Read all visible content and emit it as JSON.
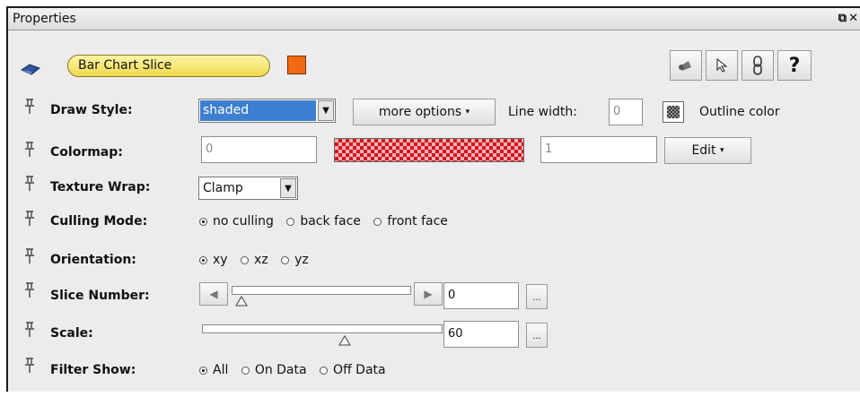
{
  "window": {
    "title": "Properties",
    "float_icon": "float-icon",
    "close_icon": "close-icon"
  },
  "header": {
    "object_name": "Bar Chart Slice",
    "color_swatch": "#f06a14",
    "toolbar": [
      "camera-icon",
      "pointer-icon",
      "link-icon",
      "help-icon"
    ],
    "help_label": "?"
  },
  "rows": {
    "draw_style": {
      "label": "Draw Style:",
      "value": "shaded",
      "more_options": "more options",
      "line_width_label": "Line width:",
      "line_width_value": "0",
      "outline_label": "Outline color"
    },
    "colormap": {
      "label": "Colormap:",
      "min_placeholder": "0",
      "max_placeholder": "1",
      "edit_label": "Edit"
    },
    "texture_wrap": {
      "label": "Texture Wrap:",
      "value": "Clamp"
    },
    "culling_mode": {
      "label": "Culling Mode:",
      "options": [
        "no culling",
        "back face",
        "front face"
      ],
      "selected": 0
    },
    "orientation": {
      "label": "Orientation:",
      "options": [
        "xy",
        "xz",
        "yz"
      ],
      "selected": 0
    },
    "slice_number": {
      "label": "Slice Number:",
      "value": "0",
      "level": 0.0,
      "more": "..."
    },
    "scale": {
      "label": "Scale:",
      "value": "60",
      "level": 0.6,
      "more": "..."
    },
    "filter_show": {
      "label": "Filter Show:",
      "options": [
        "All",
        "On Data",
        "Off Data"
      ],
      "selected": 0
    }
  }
}
